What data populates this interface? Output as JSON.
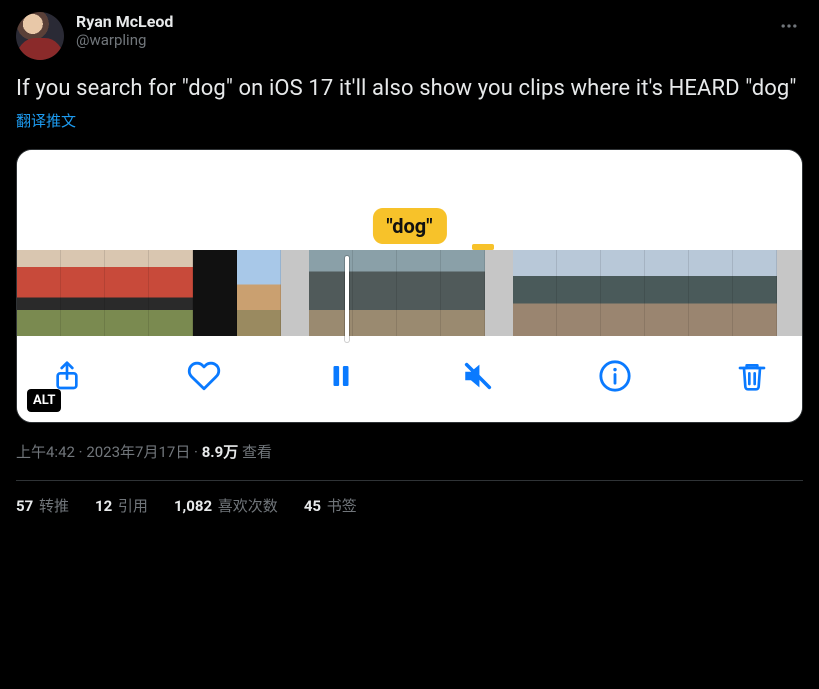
{
  "user": {
    "display_name": "Ryan McLeod",
    "handle": "@warpling"
  },
  "tweet": {
    "text": "If you search for \"dog\" on iOS 17 it'll also show you clips where it's HEARD \"dog\"",
    "translate_label": "翻译推文"
  },
  "media": {
    "bubble_text": "\"dog\"",
    "alt_badge": "ALT"
  },
  "meta": {
    "time": "上午4:42",
    "date": "2023年7月17日",
    "views_count": "8.9万",
    "views_label": "查看",
    "separator": " · "
  },
  "stats": {
    "retweets_count": "57",
    "retweets_label": "转推",
    "quotes_count": "12",
    "quotes_label": "引用",
    "likes_count": "1,082",
    "likes_label": "喜欢次数",
    "bookmarks_count": "45",
    "bookmarks_label": "书签"
  }
}
